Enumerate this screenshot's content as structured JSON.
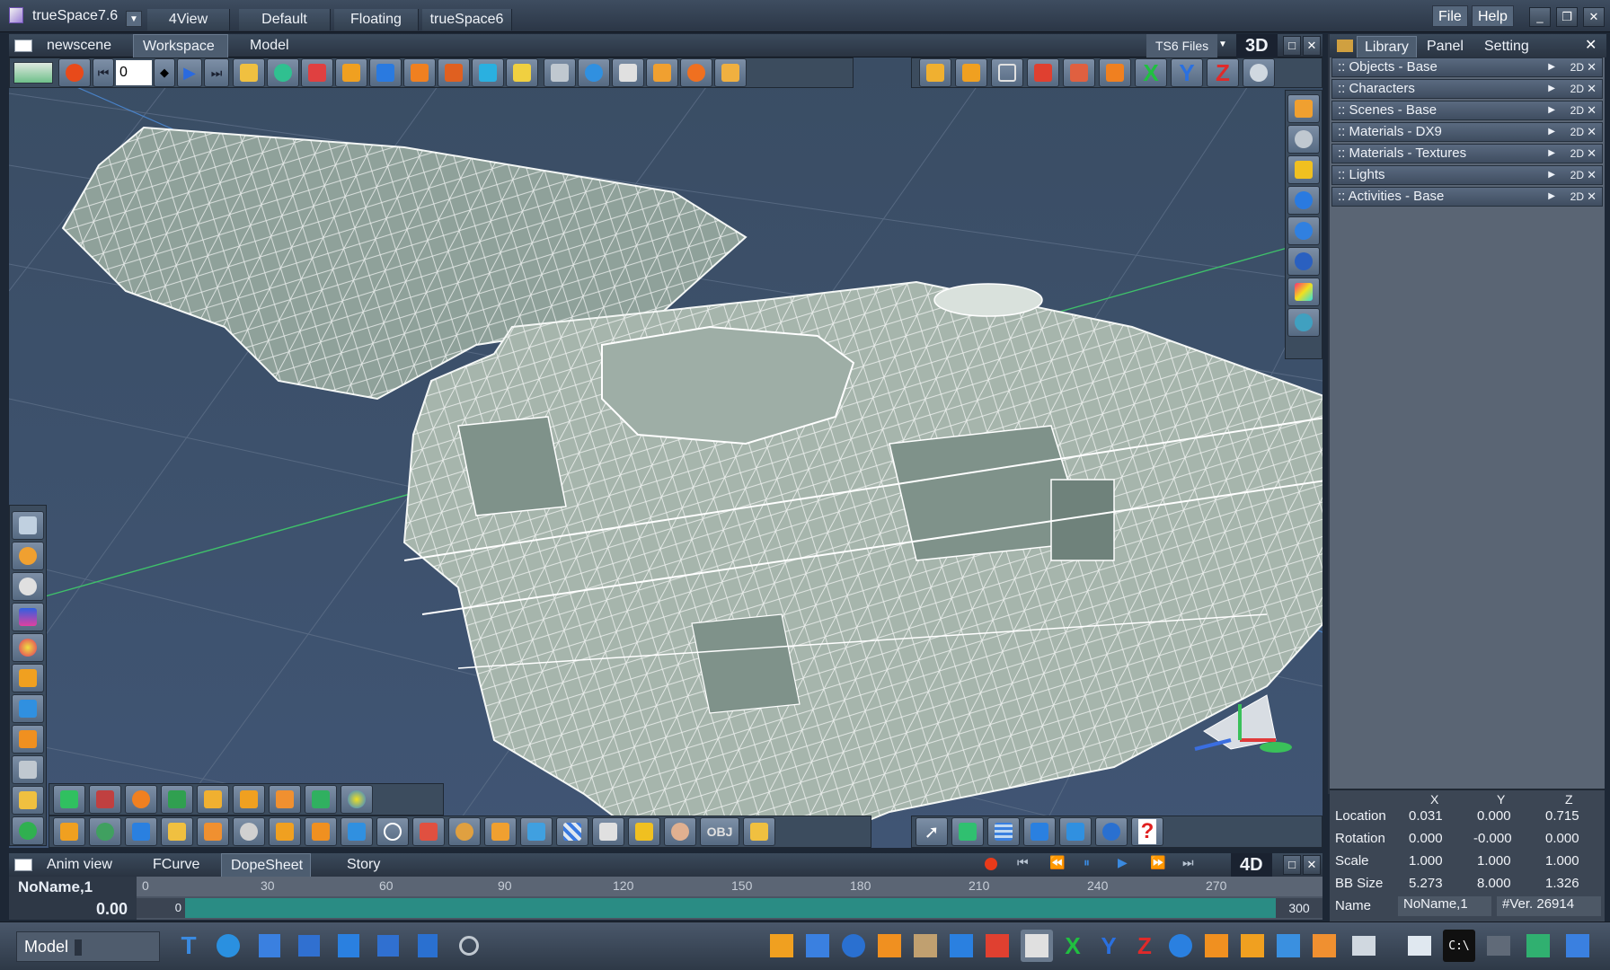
{
  "app": {
    "title": "trueSpace7.6"
  },
  "workspace_tabs": [
    "4View",
    "Default",
    "Floating",
    "trueSpace6"
  ],
  "menu": {
    "file": "File",
    "help": "Help"
  },
  "viewport": {
    "scene_name": "newscene",
    "tabs": [
      "Workspace",
      "Model"
    ],
    "active_tab": "Workspace",
    "files_label": "TS6 Files",
    "mode_label": "3D",
    "frame_value": "0"
  },
  "library": {
    "tabs": [
      "Library",
      "Panel",
      "Setting"
    ],
    "active_tab": "Library",
    "items": [
      {
        "label": ":: Objects - Base",
        "mode": "2D"
      },
      {
        "label": ":: Characters",
        "mode": "2D"
      },
      {
        "label": ":: Scenes - Base",
        "mode": "2D"
      },
      {
        "label": ":: Materials - DX9",
        "mode": "2D"
      },
      {
        "label": ":: Materials - Textures",
        "mode": "2D"
      },
      {
        "label": ":: Lights",
        "mode": "2D"
      },
      {
        "label": ":: Activities - Base",
        "mode": "2D"
      }
    ]
  },
  "properties": {
    "columns": [
      "X",
      "Y",
      "Z"
    ],
    "rows": [
      {
        "label": "Location",
        "x": "0.031",
        "y": "0.000",
        "z": "0.715"
      },
      {
        "label": "Rotation",
        "x": "0.000",
        "y": "-0.000",
        "z": "0.000"
      },
      {
        "label": "Scale",
        "x": "1.000",
        "y": "1.000",
        "z": "1.000"
      },
      {
        "label": "BB Size",
        "x": "5.273",
        "y": "8.000",
        "z": "1.326"
      }
    ],
    "name_label": "Name",
    "name_value": "NoName,1",
    "version": "#Ver. 26914"
  },
  "anim": {
    "view_label": "Anim view",
    "tabs": [
      "FCurve",
      "DopeSheet",
      "Story"
    ],
    "active_tab": "DopeSheet",
    "mode_label": "4D",
    "object_name": "NoName,1",
    "time": "0.00",
    "ruler_ticks": [
      "0",
      "30",
      "60",
      "90",
      "120",
      "150",
      "180",
      "210",
      "240",
      "270"
    ],
    "range_start": "0",
    "range_end": "300"
  },
  "status": {
    "mode": "Model"
  },
  "colors": {
    "background": "#3d5069",
    "accent": "#2a8c84",
    "mesh": "#c9d6cd"
  }
}
